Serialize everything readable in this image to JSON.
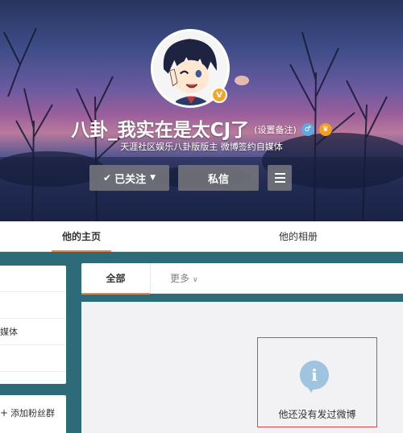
{
  "profile": {
    "name": "八卦_我实在是太CJ了",
    "remark_label": "(设置备注)",
    "intro": "天涯社区娱乐八卦版版主 微博签约自媒体",
    "verify_badge": "V",
    "badge_icon_1": "weibo-member-icon",
    "badge_icon_2": "crown-icon"
  },
  "actions": {
    "follow_label": "已关注",
    "message_label": "私信",
    "menu_icon": "hamburger-menu-icon"
  },
  "tabs": {
    "home": "他的主页",
    "album": "他的相册"
  },
  "sidebar": {
    "item_text": "媒体",
    "add_fan_group": "添加粉丝群"
  },
  "feed": {
    "tab_all": "全部",
    "tab_more": "更多",
    "empty_message": "他还没有发过微博"
  },
  "colors": {
    "accent": "#fa7d3c",
    "page_bg": "#2e6b78",
    "empty_highlight": "#e04545",
    "info_icon": "#9fc4e0"
  }
}
